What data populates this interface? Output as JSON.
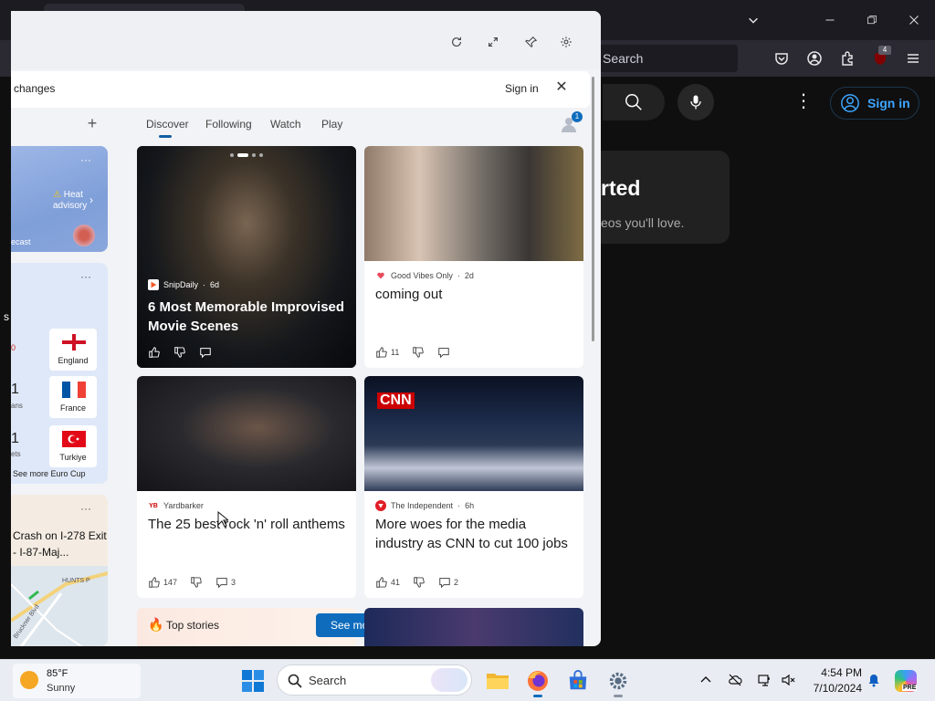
{
  "browser": {
    "search_placeholder": "Search",
    "ublock_badge": "4",
    "colors": {
      "tabbar": "#1c1b22",
      "toolbar": "#2b2a33"
    }
  },
  "youtube": {
    "sign_in": "Sign in",
    "card_title_partial": "rted",
    "card_sub_partial": "eos you'll love.",
    "left_fragment": "s",
    "accent": "#3ea6ff"
  },
  "widgets": {
    "notice": {
      "text": "changes",
      "sign_in": "Sign in"
    },
    "tabs": [
      "Discover",
      "Following",
      "Watch",
      "Play"
    ],
    "active_tab": "Discover",
    "avatar_badge": "1",
    "weather": {
      "alert": "Heat advisory",
      "forecast_partial": "ecast"
    },
    "sports": {
      "teams": [
        {
          "name": "England",
          "left_val": "0"
        },
        {
          "name": "France",
          "left_val": "1",
          "left_sub": "ans"
        },
        {
          "name": "Turkiye",
          "left_val": "1",
          "left_sub": "ets"
        }
      ],
      "see_more": "See more Euro Cup"
    },
    "traffic": {
      "title": "Crash on I-278 Exit - I-87-Maj...",
      "map_labels": [
        "HUNTS P",
        "Bruckner Blvd"
      ]
    },
    "feed": [
      {
        "source": "SnipDaily",
        "age": "6d",
        "title": "6 Most Memorable Improvised Movie Scenes",
        "likes": "",
        "comments": ""
      },
      {
        "source": "Good Vibes Only",
        "age": "2d",
        "title": "coming out",
        "likes": "11",
        "comments": ""
      },
      {
        "source": "Yardbarker",
        "age": "",
        "title": "The 25 best rock 'n' roll anthems",
        "likes": "147",
        "comments": "3"
      },
      {
        "source": "The Independent",
        "age": "6h",
        "title": "More woes for the media industry as CNN to cut 100 jobs",
        "likes": "41",
        "comments": "2"
      }
    ],
    "top_stories": "Top stories",
    "see_more": "See more",
    "cnn_logo": "CNN"
  },
  "taskbar": {
    "temp": "85°F",
    "condition": "Sunny",
    "search": "Search",
    "time": "4:54 PM",
    "date": "7/10/2024",
    "copilot_badge": "PRE"
  }
}
